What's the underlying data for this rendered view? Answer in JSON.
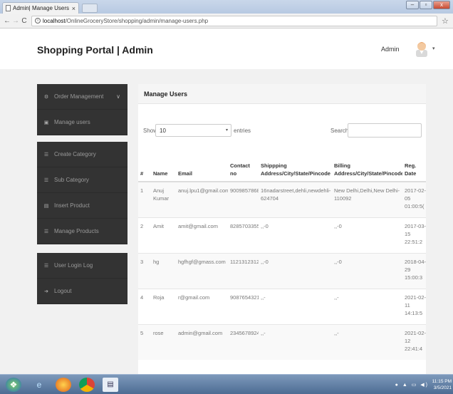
{
  "browser": {
    "tab_title": "Admin| Manage Users",
    "tab_close": "×",
    "back": "←",
    "forward": "→",
    "reload": "C",
    "url_host": "localhost",
    "url_path": "/OnlineGroceryStore/shopping/admin/manage-users.php",
    "bookmark": "☆",
    "window_controls": [
      "–",
      "▫",
      "x"
    ]
  },
  "header": {
    "brand": "Shopping Portal | Admin",
    "user": "Admin",
    "caret": "▾"
  },
  "sidebar": {
    "group1": [
      {
        "label": "Order Management",
        "icon": "gear-icon",
        "glyph": "⚙",
        "chevron": "∨"
      },
      {
        "label": "Manage users",
        "icon": "users-icon",
        "glyph": "▣"
      }
    ],
    "group2": [
      {
        "label": "Create Category",
        "icon": "list-icon",
        "glyph": "☰"
      },
      {
        "label": "Sub Category",
        "icon": "list-icon",
        "glyph": "☰"
      },
      {
        "label": "Insert Product",
        "icon": "copy-icon",
        "glyph": "▤"
      },
      {
        "label": "Manage Products",
        "icon": "list-icon",
        "glyph": "☰"
      }
    ],
    "group3": [
      {
        "label": "User Login Log",
        "icon": "list-icon",
        "glyph": "☰"
      },
      {
        "label": "Logout",
        "icon": "logout-icon",
        "glyph": "➔"
      }
    ]
  },
  "panel": {
    "title": "Manage Users",
    "show_label": "Show",
    "page_length": "10",
    "select_arrow": "▾",
    "entries_label": "entries",
    "search_label": "Search:"
  },
  "table": {
    "headers": [
      "#",
      "Name",
      "Email",
      "Contact no",
      "Shippping Address/City/State/Pincode",
      "Billing Address/City/State/Pincode",
      "Reg. Date"
    ],
    "rows": [
      [
        "1",
        "Anuj Kumar",
        "anuj.lpu1@gmail.com",
        "9009857868",
        "16nadarstreet,dehli,newdehli-624704",
        "New Delhi,Delhi,New Delhi-110092",
        "2017-02-05 01:00:5("
      ],
      [
        "2",
        "Amit",
        "amit@gmail.com",
        "8285703355",
        ",,-0",
        ",,-0",
        "2017-03-15 22:51:2"
      ],
      [
        "3",
        "hg",
        "hgfhgf@gmass.com",
        "1121312312",
        ",,-0",
        ",,-0",
        "2018-04-29 15:00:3"
      ],
      [
        "4",
        "Roja",
        "r@gmail.com",
        "9087654321",
        ",,-",
        ",,-",
        "2021-02-11 14:13:5"
      ],
      [
        "5",
        "rose",
        "admin@gmail.com",
        "2345678924",
        ",,-",
        ",,-",
        "2021-02-12 22:41:4"
      ]
    ]
  },
  "taskbar": {
    "clock_time": "11:15 PM",
    "clock_date": "3/5/2021"
  }
}
